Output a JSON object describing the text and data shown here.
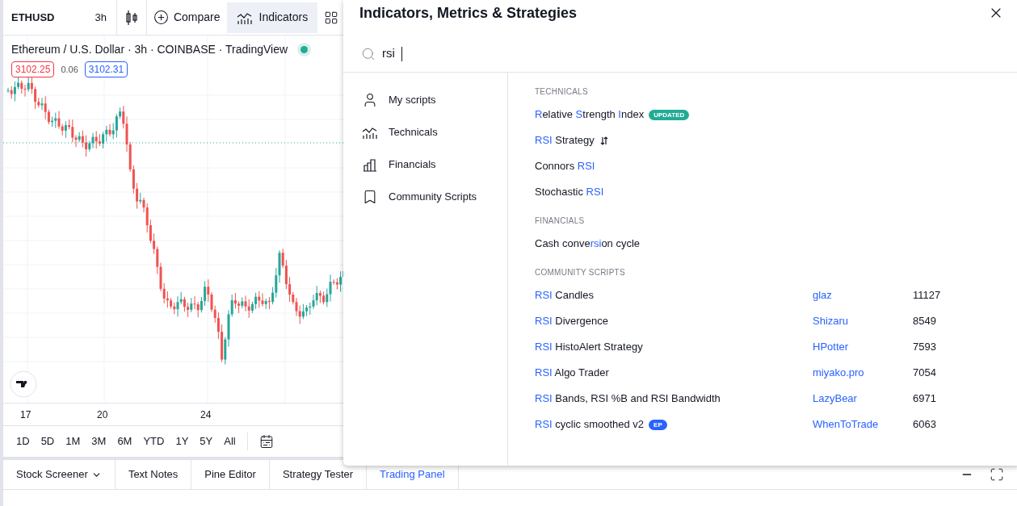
{
  "toolbar": {
    "symbol": "ETHUSD",
    "interval": "3h",
    "compare": "Compare",
    "indicators": {
      "label": "Indicators",
      "selected": true
    }
  },
  "legend": {
    "title": "Ethereum / U.S. Dollar · 3h · COINBASE · TradingView",
    "live": true,
    "sell": "3102.25",
    "spread": "0.06",
    "buy": "3102.31"
  },
  "time_axis": [
    "17",
    "20",
    "24"
  ],
  "ranges": [
    "1D",
    "5D",
    "1M",
    "3M",
    "6M",
    "YTD",
    "1Y",
    "5Y",
    "All"
  ],
  "bottom_tabs": [
    {
      "label": "Stock Screener",
      "selected": false,
      "dropdown": true
    },
    {
      "label": "Text Notes",
      "selected": false,
      "dropdown": false
    },
    {
      "label": "Pine Editor",
      "selected": false,
      "dropdown": false
    },
    {
      "label": "Strategy Tester",
      "selected": false,
      "dropdown": false
    },
    {
      "label": "Trading Panel",
      "selected": true,
      "dropdown": false
    }
  ],
  "dialog": {
    "title": "Indicators, Metrics & Strategies",
    "search": {
      "value": "rsi"
    },
    "nav": [
      {
        "label": "My scripts",
        "kind": "person"
      },
      {
        "label": "Technicals",
        "kind": "technicals"
      },
      {
        "label": "Financials",
        "kind": "financials"
      },
      {
        "label": "Community Scripts",
        "kind": "bookmark"
      }
    ],
    "sections": [
      {
        "heading": "TECHNICALS",
        "items": [
          {
            "name": "**R**elative **S**trength **I**ndex",
            "badge": {
              "text": "UPDATED",
              "kind": "updated"
            }
          },
          {
            "name": "**RSI** Strategy",
            "kind": "strategy"
          },
          {
            "name": "Connors **RSI**"
          },
          {
            "name": "Stochastic **RSI**"
          }
        ]
      },
      {
        "heading": "FINANCIALS",
        "items": [
          {
            "name": "Cash conve**rsi**on cycle"
          }
        ]
      },
      {
        "heading": "COMMUNITY SCRIPTS",
        "items": [
          {
            "name": "**RSI** Candles",
            "author": "glaz",
            "count": "11127"
          },
          {
            "name": "**RSI** Divergence",
            "author": "Shizaru",
            "count": "8549"
          },
          {
            "name": "**RSI** HistoAlert Strategy",
            "author": "HPotter",
            "count": "7593"
          },
          {
            "name": "**RSI** Algo Trader",
            "author": "miyako.pro",
            "count": "7054"
          },
          {
            "name": "**RSI** Bands, RSI %B and RSI Bandwidth",
            "author": "LazyBear",
            "count": "6971"
          },
          {
            "name": "**RSI** cyclic smoothed v2",
            "badge": {
              "text": "EP",
              "kind": "ep"
            },
            "author": "WhenToTrade",
            "count": "6063"
          }
        ]
      }
    ]
  }
}
